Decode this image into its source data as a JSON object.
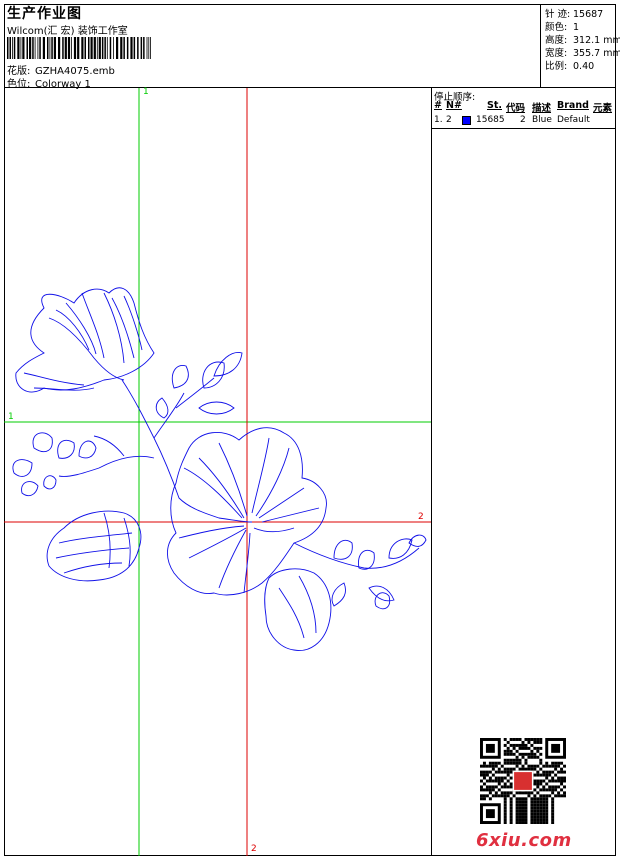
{
  "header": {
    "title": "生产作业图",
    "company": "Wilcom(汇 宏) 装饰工作室",
    "design_label": "花版:",
    "design_value": "GZHA4075.emb",
    "colorway_label": "色位:",
    "colorway_value": "Colorway 1"
  },
  "stats": {
    "stitches_label": "针 迹:",
    "stitches_value": "15687",
    "colors_label": "颜色:",
    "colors_value": "1",
    "height_label": "高度:",
    "height_value": "312.1 mm",
    "width_label": "宽度:",
    "width_value": "355.7 mm",
    "scale_label": "比例:",
    "scale_value": "0.40"
  },
  "stop_sequence": {
    "title": "停止顺序:",
    "columns": [
      "#",
      "N#",
      "St.",
      "代码",
      "描述",
      "Brand",
      "元素"
    ],
    "rows": [
      {
        "index": "1.",
        "needle": "2",
        "stitches": "15685",
        "code": "2",
        "description": "Blue",
        "brand": "Default",
        "color": "#0000ff"
      }
    ]
  },
  "guides": {
    "green_label": "1",
    "red_label": "2",
    "green_color": "#00cc00",
    "red_color": "#dd0000"
  },
  "design": {
    "thread_color": "#1010e8"
  },
  "watermark": {
    "logo_text": "6xiu.com"
  }
}
